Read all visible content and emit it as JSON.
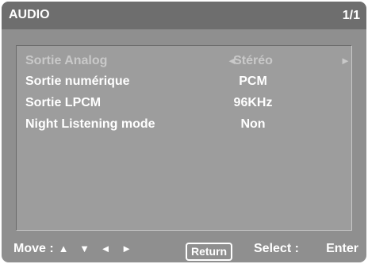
{
  "header": {
    "title": "AUDIO",
    "page": "1/1"
  },
  "menu": {
    "items": [
      {
        "label": "Sortie Analog",
        "value": "Stéréo"
      },
      {
        "label": "Sortie numérique",
        "value": "PCM"
      },
      {
        "label": "Sortie LPCM",
        "value": "96KHz"
      },
      {
        "label": "Night Listening mode",
        "value": "Non"
      }
    ],
    "arrow_left": "◄",
    "arrow_right": "►"
  },
  "footer": {
    "move_label": "Move :",
    "move_keys": "▲ ▼ ◄ ►",
    "return_label": "Return",
    "select_label": "Select :",
    "enter_label": "Enter"
  },
  "colors": {
    "osd_background": "#8f8f8f",
    "header_background": "#6e6e6e",
    "panel_background": "#9d9d9d",
    "text": "#ffffff",
    "disabled_text": "#c9c9c9"
  }
}
